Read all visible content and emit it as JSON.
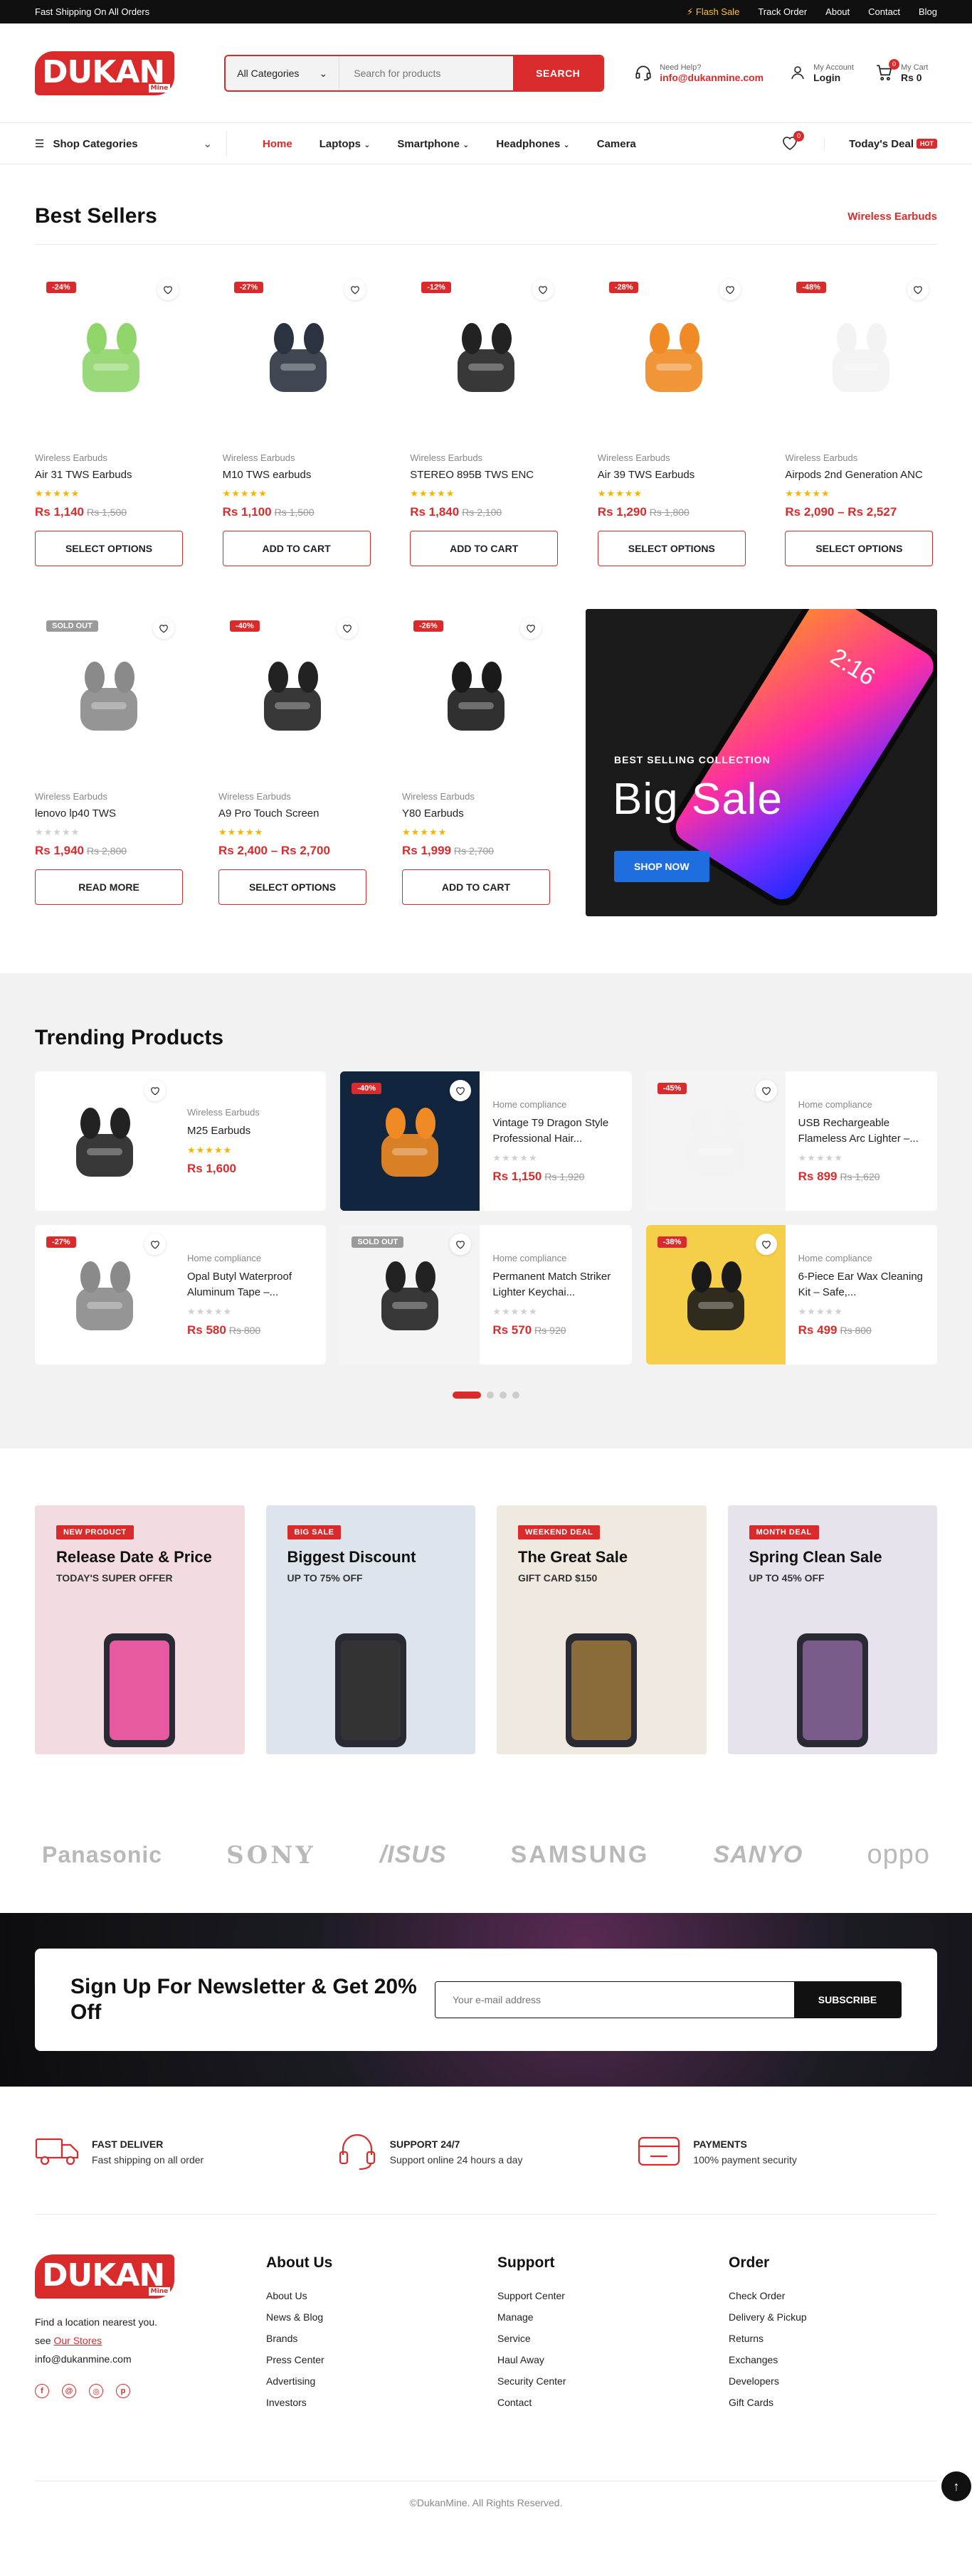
{
  "topbar": {
    "shipping": "Fast Shipping On All Orders",
    "flash": "⚡ Flash Sale",
    "links": [
      "Track Order",
      "About",
      "Contact",
      "Blog"
    ]
  },
  "brand": {
    "logo_text": "DUKAN",
    "logo_tag": "Mine",
    "accent": "#d92b2b"
  },
  "search": {
    "category": "All Categories",
    "placeholder": "Search for products",
    "button": "SEARCH"
  },
  "help": {
    "label": "Need Help?",
    "email": "info@dukanmine.com"
  },
  "account": {
    "label": "My Account",
    "action": "Login"
  },
  "cart": {
    "label": "My Cart",
    "total": "Rs 0",
    "count": "0"
  },
  "nav": {
    "shop_categories": "Shop Categories",
    "items": [
      "Home",
      "Laptops",
      "Smartphone",
      "Headphones",
      "Camera"
    ],
    "wishlist_count": "0",
    "deal": "Today's Deal",
    "hot": "HOT"
  },
  "bestsellers": {
    "title": "Best Sellers",
    "link": "Wireless Earbuds",
    "products": [
      {
        "badge": "-24%",
        "cat": "Wireless Earbuds",
        "name": "Air 31 TWS Earbuds",
        "price": "Rs 1,140",
        "old": "Rs 1,500",
        "btn": "SELECT OPTIONS",
        "rated": true
      },
      {
        "badge": "-27%",
        "cat": "Wireless Earbuds",
        "name": "M10 TWS earbuds",
        "price": "Rs 1,100",
        "old": "Rs 1,500",
        "btn": "ADD TO CART",
        "rated": true
      },
      {
        "badge": "-12%",
        "cat": "Wireless Earbuds",
        "name": "STEREO 895B TWS ENC",
        "price": "Rs 1,840",
        "old": "Rs 2,100",
        "btn": "ADD TO CART",
        "rated": true
      },
      {
        "badge": "-28%",
        "cat": "Wireless Earbuds",
        "name": "Air 39 TWS Earbuds",
        "price": "Rs 1,290",
        "old": "Rs 1,800",
        "btn": "SELECT OPTIONS",
        "rated": true
      },
      {
        "badge": "-48%",
        "cat": "Wireless Earbuds",
        "name": "Airpods 2nd Generation ANC",
        "price": "Rs 2,090 – Rs 2,527",
        "old": "",
        "btn": "SELECT OPTIONS",
        "rated": true
      },
      {
        "badge": "SOLD OUT",
        "cat": "Wireless Earbuds",
        "name": "lenovo lp40 TWS",
        "price": "Rs 1,940",
        "old": "Rs 2,800",
        "btn": "READ MORE",
        "rated": false
      },
      {
        "badge": "-40%",
        "cat": "Wireless Earbuds",
        "name": "A9 Pro Touch Screen",
        "price": "Rs 2,400 – Rs 2,700",
        "old": "",
        "btn": "SELECT OPTIONS",
        "rated": true
      },
      {
        "badge": "-26%",
        "cat": "Wireless Earbuds",
        "name": "Y80 Earbuds",
        "price": "Rs 1,999",
        "old": "Rs 2,700",
        "btn": "ADD TO CART",
        "rated": true
      }
    ]
  },
  "banner": {
    "sub": "BEST SELLING COLLECTION",
    "title": "Big Sale",
    "button": "SHOP NOW",
    "phone_time": "2:16"
  },
  "trending": {
    "title": "Trending Products",
    "products": [
      {
        "badge": "",
        "cat": "Wireless Earbuds",
        "name": "M25 Earbuds",
        "price": "Rs 1,600",
        "old": "",
        "rated": true
      },
      {
        "badge": "-40%",
        "cat": "Home compliance",
        "name": "Vintage T9 Dragon Style Professional Hair...",
        "price": "Rs 1,150",
        "old": "Rs 1,920",
        "rated": false
      },
      {
        "badge": "-45%",
        "cat": "Home compliance",
        "name": "USB Rechargeable Flameless Arc Lighter –...",
        "price": "Rs 899",
        "old": "Rs 1,620",
        "rated": false
      },
      {
        "badge": "-27%",
        "cat": "Home compliance",
        "name": "Opal Butyl Waterproof Aluminum Tape –...",
        "price": "Rs 580",
        "old": "Rs 800",
        "rated": false
      },
      {
        "badge": "SOLD OUT",
        "cat": "Home compliance",
        "name": "Permanent Match Striker Lighter Keychai...",
        "price": "Rs 570",
        "old": "Rs 920",
        "rated": false
      },
      {
        "badge": "-38%",
        "cat": "Home compliance",
        "name": "6-Piece Ear Wax Cleaning Kit – Safe,...",
        "price": "Rs 499",
        "old": "Rs 800",
        "rated": false
      }
    ]
  },
  "promos": [
    {
      "tag": "NEW PRODUCT",
      "title": "Release Date & Price",
      "sub": "TODAY'S SUPER OFFER",
      "bg": "#f3dce1"
    },
    {
      "tag": "BIG SALE",
      "title": "Biggest Discount",
      "sub": "UP TO 75% OFF",
      "bg": "#dde4ec"
    },
    {
      "tag": "WEEKEND DEAL",
      "title": "The Great Sale",
      "sub": "GIFT CARD $150",
      "bg": "#efe9df"
    },
    {
      "tag": "MONTH DEAL",
      "title": "Spring Clean Sale",
      "sub": "UP TO 45% OFF",
      "bg": "#e6e3ec"
    }
  ],
  "brands": [
    "Panasonic",
    "SONY",
    "/ISUS",
    "SAMSUNG",
    "SANYO",
    "oppo"
  ],
  "newsletter": {
    "title": "Sign Up For Newsletter & Get 20% Off",
    "placeholder": "Your e-mail address",
    "button": "SUBSCRIBE"
  },
  "features": [
    {
      "title": "FAST DELIVER",
      "desc": "Fast shipping on all order"
    },
    {
      "title": "SUPPORT 24/7",
      "desc": "Support online 24 hours a day"
    },
    {
      "title": "PAYMENTS",
      "desc": "100% payment security"
    }
  ],
  "footer": {
    "about_line1": "Find a location nearest you.",
    "about_see": "see",
    "about_link": "Our Stores",
    "email": "info@dukanmine.com",
    "cols": [
      {
        "title": "About Us",
        "links": [
          "About Us",
          "News & Blog",
          "Brands",
          "Press Center",
          "Advertising",
          "Investors"
        ]
      },
      {
        "title": "Support",
        "links": [
          "Support Center",
          "Manage",
          "Service",
          "Haul Away",
          "Security Center",
          "Contact"
        ]
      },
      {
        "title": "Order",
        "links": [
          "Check Order",
          "Delivery & Pickup",
          "Returns",
          "Exchanges",
          "Developers",
          "Gift Cards"
        ]
      }
    ],
    "copyright": "©DukanMine. All Rights Reserved."
  }
}
